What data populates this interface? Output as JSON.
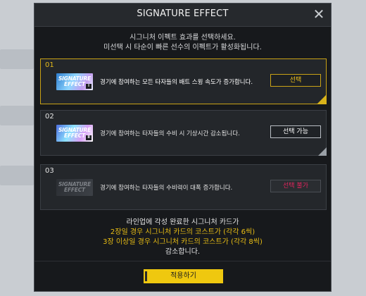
{
  "modal": {
    "title": "SIGNATURE EFFECT",
    "intro": [
      "시그니처 이펙트 효과를 선택하세요.",
      "미선택 시 타순이 빠른 선수의 이펙트가 활성화됩니다."
    ]
  },
  "cards": [
    {
      "number": "01",
      "badge_line1": "SIGNATURE",
      "badge_line2": "EFFECT",
      "tier": "I",
      "description": "경기에 참여하는 모든 타자들의 배트 스윙 속도가 증가합니다.",
      "button": "선택",
      "state": "selected"
    },
    {
      "number": "02",
      "badge_line1": "SIGNATURE",
      "badge_line2": "EFFECT",
      "tier": "II",
      "description": "경기에 참여하는 타자들의 수비 시 기상시간 감소됩니다.",
      "button": "선택 가능",
      "state": "available"
    },
    {
      "number": "03",
      "badge_line1": "SIGNATURE",
      "badge_line2": "EFFECT",
      "tier": "",
      "description": "경기에 참여하는 타자들의 수비력이 대폭 증가합니다.",
      "button": "선택 불가",
      "state": "disabled"
    }
  ],
  "footer": {
    "lines": [
      "라인업에 각성 완료한 시그니처 카드가",
      "2장일 경우 시그니처 카드의 코스트가 (각각 6씩)",
      "3장 이상일 경우 시그니처 카드의 코스트가 (각각 8씩)",
      "감소합니다."
    ]
  },
  "apply_button": "적용하기",
  "colors": {
    "accent": "#efc80f",
    "disabled_text": "#e0245c",
    "panel": "#17191c"
  }
}
